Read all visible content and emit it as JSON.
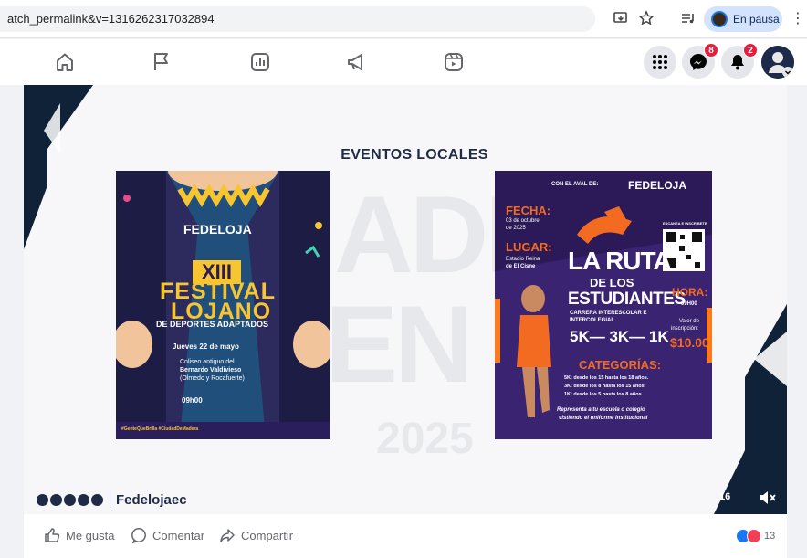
{
  "browser": {
    "url": "atch_permalink&v=1316262317032894",
    "media_status": "En pausa"
  },
  "nav": {
    "messenger_badge": "8",
    "notifications_badge": "2"
  },
  "slide": {
    "title": "EVENTOS LOCALES",
    "watermark_year": "2025",
    "left_poster": {
      "org": "FEDELOJA",
      "edition": "XIII",
      "line1": "FESTIVAL",
      "line2": "LOJANO",
      "subtitle": "DE DEPORTES ADAPTADOS",
      "date": "Jueves 22 de mayo",
      "venue_1": "Coliseo antiguo del",
      "venue_2": "Bernardo Valdivieso",
      "venue_3": "(Olmedo y Rocafuerte)",
      "time": "09h00",
      "hashtags": "#GenteQueBrilla  #CiudadDeMadera"
    },
    "right_poster": {
      "aval": "CON EL AVAL DE:",
      "org": "FEDELOJA",
      "fecha_label": "FECHA:",
      "fecha_value_1": "03 de octubre",
      "fecha_value_2": "de 2025",
      "lugar_label": "LUGAR:",
      "lugar_value_1": "Estadio Reina",
      "lugar_value_2": "de El Cisne",
      "scan": "ESCANEA E INSCRÍBETE",
      "title_1": "LA RUTA",
      "title_2": "DE LOS",
      "title_3": "ESTUDIANTES",
      "carrera_1": "CARRERA INTERESCOLAR E",
      "carrera_2": "INTERCOLEGIAL",
      "distances": "5K— 3K— 1K",
      "hora_label": "HORA:",
      "hora_value": "09H00",
      "valor_label_1": "Valor de",
      "valor_label_2": "inscripción:",
      "valor_value": "$10.00",
      "categorias_label": "CATEGORÍAS:",
      "cat_5k": "5K: desde los 15  hasta los 18 años.",
      "cat_3k": "3K: desde los 8  hasta los 15 años.",
      "cat_1k": "1K: desde los 5  hasta los 8 años.",
      "represent_1": "Representa a tu escuela o colegio",
      "represent_2": "vistiendo el uniforme institucional"
    },
    "brand": "Fedelojaec",
    "video_time": "16"
  },
  "actions": {
    "like": "Me gusta",
    "comment": "Comentar",
    "share": "Compartir",
    "reaction_count": "13"
  }
}
